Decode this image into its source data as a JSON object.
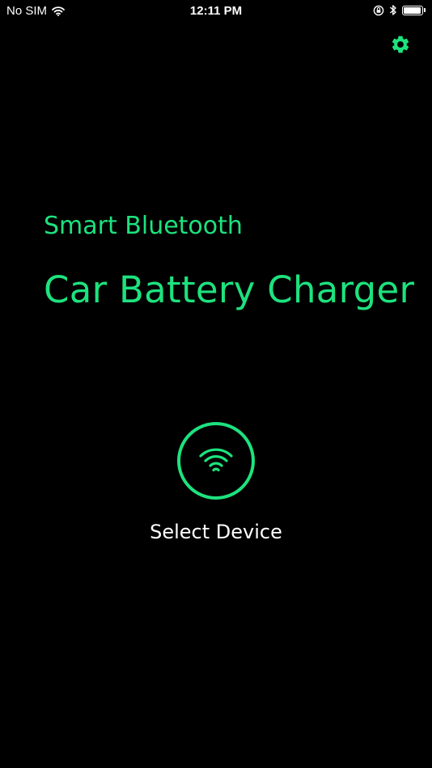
{
  "status_bar": {
    "carrier": "No SIM",
    "time": "12:11 PM",
    "battery_level": 0.95,
    "icons": [
      "wifi-icon",
      "orientation-lock-icon",
      "bluetooth-icon",
      "battery-icon"
    ]
  },
  "header": {
    "settings_icon": "gear-icon"
  },
  "main": {
    "subtitle": "Smart Bluetooth",
    "title": "Car Battery Charger",
    "select_device_icon": "wifi-signal-icon",
    "select_device_label": "Select Device"
  },
  "colors": {
    "background": "#000000",
    "accent": "#1de27e",
    "text": "#ffffff"
  }
}
